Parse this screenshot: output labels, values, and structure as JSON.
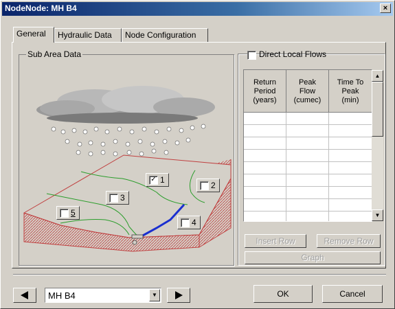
{
  "window": {
    "title": "NodeNode: MH B4",
    "close_label": "×"
  },
  "tabs": [
    {
      "label": "General",
      "active": true
    },
    {
      "label": "Hydraulic Data",
      "active": false
    },
    {
      "label": "Node Configuration",
      "active": false
    }
  ],
  "sub_area": {
    "group_label": "Sub Area Data",
    "areas": [
      {
        "label": "1",
        "checked": true
      },
      {
        "label": "2",
        "checked": false
      },
      {
        "label": "3",
        "checked": false
      },
      {
        "label": "4",
        "checked": false
      },
      {
        "label": "5",
        "checked": false
      }
    ]
  },
  "local_flows": {
    "checkbox_label": "Direct Local Flows",
    "checked": false,
    "columns": [
      {
        "line1": "Return",
        "line2": "Period",
        "line3": "(years)"
      },
      {
        "line1": "Peak",
        "line2": "Flow",
        "line3": "(cumec)"
      },
      {
        "line1": "Time To",
        "line2": "Peak",
        "line3": "(min)"
      }
    ],
    "insert_label": "Insert Row",
    "remove_label": "Remove Row",
    "graph_label": "Graph"
  },
  "footer": {
    "node_value": "MH B4",
    "ok_label": "OK",
    "cancel_label": "Cancel"
  },
  "colors": {
    "title_gradient_start": "#0a246a",
    "catchment_outline": "#c04040",
    "stream": "#2a9d2a",
    "channel": "#1a2fd0"
  }
}
